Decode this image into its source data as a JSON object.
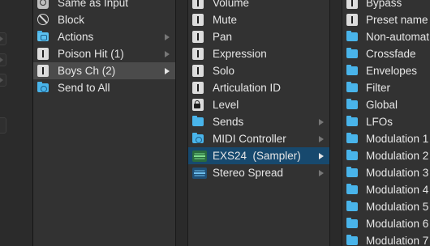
{
  "column1": {
    "items": [
      {
        "label": "Same as Input",
        "icon": "gear-icon",
        "arrow": false
      },
      {
        "label": "Block",
        "icon": "block-icon",
        "arrow": false
      },
      {
        "label": "Actions",
        "icon": "folder-icon",
        "arrow": true
      },
      {
        "label": "Poison Hit (1)",
        "icon": "fader-icon",
        "arrow": true
      },
      {
        "label": "Boys Ch (2)",
        "icon": "fader-icon",
        "arrow": true,
        "selected": true
      },
      {
        "label": "Send to All",
        "icon": "folder-icon",
        "arrow": false
      }
    ]
  },
  "column2": {
    "items": [
      {
        "label": "Volume",
        "icon": "fader-icon"
      },
      {
        "label": "Mute",
        "icon": "fader-icon"
      },
      {
        "label": "Pan",
        "icon": "fader-icon"
      },
      {
        "label": "Expression",
        "icon": "fader-icon"
      },
      {
        "label": "Solo",
        "icon": "fader-icon"
      },
      {
        "label": "Articulation ID",
        "icon": "fader-icon"
      },
      {
        "label": "Level",
        "icon": "lock-fader-icon"
      },
      {
        "label": "Sends",
        "icon": "folder-icon",
        "arrow": true
      },
      {
        "label": "MIDI Controller",
        "icon": "folder-icon",
        "arrow": true
      },
      {
        "label": "EXS24  (Sampler)",
        "icon": "exs24-plugin-icon",
        "arrow": true,
        "highlighted": true
      },
      {
        "label": "Stereo Spread",
        "icon": "stereo-spread-plugin-icon",
        "arrow": true
      }
    ]
  },
  "column3": {
    "items": [
      {
        "label": "Bypass",
        "icon": "fader-icon"
      },
      {
        "label": "Preset name",
        "icon": "fader-icon"
      },
      {
        "label": "Non-automat",
        "icon": "folder-icon"
      },
      {
        "label": "Crossfade",
        "icon": "folder-icon"
      },
      {
        "label": "Envelopes",
        "icon": "folder-icon"
      },
      {
        "label": "Filter",
        "icon": "folder-icon"
      },
      {
        "label": "Global",
        "icon": "folder-icon"
      },
      {
        "label": "LFOs",
        "icon": "folder-icon"
      },
      {
        "label": "Modulation 1",
        "icon": "folder-icon"
      },
      {
        "label": "Modulation 2",
        "icon": "folder-icon"
      },
      {
        "label": "Modulation 3",
        "icon": "folder-icon"
      },
      {
        "label": "Modulation 4",
        "icon": "folder-icon"
      },
      {
        "label": "Modulation 5",
        "icon": "folder-icon"
      },
      {
        "label": "Modulation 6",
        "icon": "folder-icon"
      },
      {
        "label": "Modulation 7",
        "icon": "folder-icon"
      }
    ]
  },
  "colors": {
    "selected_row": "#4b4b4b",
    "highlight_row": "#17496e",
    "folder": "#49b4ea"
  }
}
